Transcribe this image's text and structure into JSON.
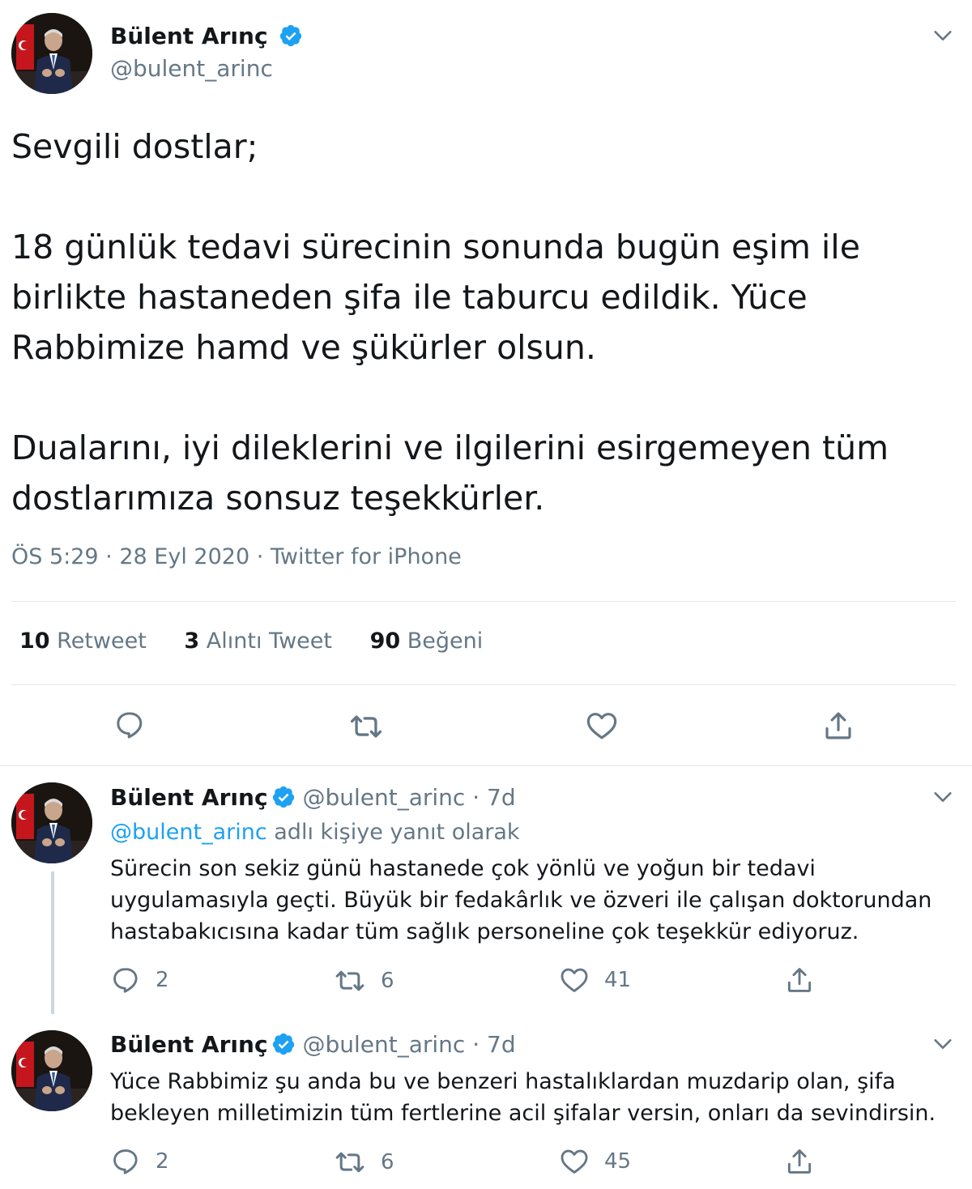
{
  "main_tweet": {
    "author_name": "Bülent Arınç",
    "author_handle": "@bulent_arinc",
    "paragraphs": [
      "Sevgili dostlar;",
      "18 günlük tedavi sürecinin sonunda bugün eşim ile birlikte hastaneden şifa ile taburcu edildik. Yüce Rabbimize hamd ve şükürler olsun.",
      "Dualarını, iyi dileklerini ve ilgilerini esirgemeyen tüm dostlarımıza sonsuz teşekkürler."
    ],
    "timestamp": "ÖS 5:29 · 28 Eyl 2020 · Twitter for iPhone",
    "stats": {
      "retweets_count": "10",
      "retweets_label": "Retweet",
      "quotes_count": "3",
      "quotes_label": "Alıntı Tweet",
      "likes_count": "90",
      "likes_label": "Beğeni"
    }
  },
  "replies": [
    {
      "author_name": "Bülent Arınç",
      "author_handle": "@bulent_arinc",
      "time": "· 7d",
      "replying_to_handle": "@bulent_arinc",
      "replying_to_suffix": "adlı kişiye yanıt olarak",
      "text": "Sürecin son sekiz günü hastanede çok yönlü ve yoğun bir tedavi uygulamasıyla geçti. Büyük bir fedakârlık ve özveri ile çalışan doktorundan hastabakıcısına kadar tüm sağlık personeline çok teşekkür ediyoruz.",
      "reply_count": "2",
      "retweet_count": "6",
      "like_count": "41"
    },
    {
      "author_name": "Bülent Arınç",
      "author_handle": "@bulent_arinc",
      "time": "· 7d",
      "text": "Yüce Rabbimiz şu anda bu ve benzeri hastalıklardan muzdarip olan, şifa bekleyen milletimizin tüm fertlerine acil şifalar versin, onları da sevindirsin.",
      "reply_count": "2",
      "retweet_count": "6",
      "like_count": "45"
    }
  ],
  "icons": {
    "verified": "verified-badge-icon",
    "more": "chevron-down-icon",
    "reply": "speech-bubble-icon",
    "retweet": "retweet-arrows-icon",
    "like": "heart-icon",
    "share": "share-upload-icon"
  },
  "colors": {
    "accent": "#1da1f2",
    "text": "#14171a",
    "secondary": "#657786",
    "divider": "#e1e8ed"
  }
}
